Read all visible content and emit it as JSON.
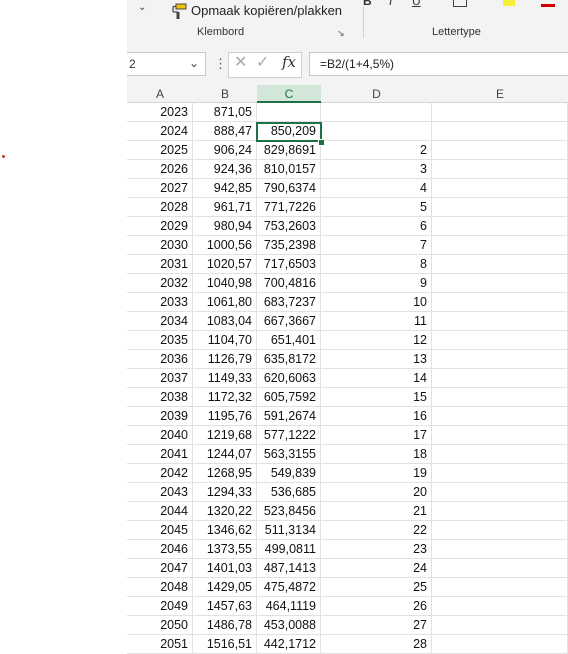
{
  "ribbon": {
    "copy_format_label": "Opmaak kopiëren/plakken",
    "clipboard_group": "Klembord",
    "font_group": "Lettertype",
    "bold": "B",
    "italic": "I",
    "underline": "U"
  },
  "formula_bar": {
    "name_box": "2",
    "formula": "=B2/(1+4,5%)",
    "fx": "fx"
  },
  "columns": [
    "A",
    "B",
    "C",
    "D",
    "E"
  ],
  "selected_column": "C",
  "active_cell": "C2",
  "accent_color": "#1e7145",
  "rows": [
    {
      "a": "2023",
      "b": "871,05",
      "c": "",
      "d": ""
    },
    {
      "a": "2024",
      "b": "888,47",
      "c": "850,209",
      "d": ""
    },
    {
      "a": "2025",
      "b": "906,24",
      "c": "829,8691",
      "d": "2"
    },
    {
      "a": "2026",
      "b": "924,36",
      "c": "810,0157",
      "d": "3"
    },
    {
      "a": "2027",
      "b": "942,85",
      "c": "790,6374",
      "d": "4"
    },
    {
      "a": "2028",
      "b": "961,71",
      "c": "771,7226",
      "d": "5"
    },
    {
      "a": "2029",
      "b": "980,94",
      "c": "753,2603",
      "d": "6"
    },
    {
      "a": "2030",
      "b": "1000,56",
      "c": "735,2398",
      "d": "7"
    },
    {
      "a": "2031",
      "b": "1020,57",
      "c": "717,6503",
      "d": "8"
    },
    {
      "a": "2032",
      "b": "1040,98",
      "c": "700,4816",
      "d": "9"
    },
    {
      "a": "2033",
      "b": "1061,80",
      "c": "683,7237",
      "d": "10"
    },
    {
      "a": "2034",
      "b": "1083,04",
      "c": "667,3667",
      "d": "11"
    },
    {
      "a": "2035",
      "b": "1104,70",
      "c": "651,401",
      "d": "12"
    },
    {
      "a": "2036",
      "b": "1126,79",
      "c": "635,8172",
      "d": "13"
    },
    {
      "a": "2037",
      "b": "1149,33",
      "c": "620,6063",
      "d": "14"
    },
    {
      "a": "2038",
      "b": "1172,32",
      "c": "605,7592",
      "d": "15"
    },
    {
      "a": "2039",
      "b": "1195,76",
      "c": "591,2674",
      "d": "16"
    },
    {
      "a": "2040",
      "b": "1219,68",
      "c": "577,1222",
      "d": "17"
    },
    {
      "a": "2041",
      "b": "1244,07",
      "c": "563,3155",
      "d": "18"
    },
    {
      "a": "2042",
      "b": "1268,95",
      "c": "549,839",
      "d": "19"
    },
    {
      "a": "2043",
      "b": "1294,33",
      "c": "536,685",
      "d": "20"
    },
    {
      "a": "2044",
      "b": "1320,22",
      "c": "523,8456",
      "d": "21"
    },
    {
      "a": "2045",
      "b": "1346,62",
      "c": "511,3134",
      "d": "22"
    },
    {
      "a": "2046",
      "b": "1373,55",
      "c": "499,0811",
      "d": "23"
    },
    {
      "a": "2047",
      "b": "1401,03",
      "c": "487,1413",
      "d": "24"
    },
    {
      "a": "2048",
      "b": "1429,05",
      "c": "475,4872",
      "d": "25"
    },
    {
      "a": "2049",
      "b": "1457,63",
      "c": "464,1119",
      "d": "26"
    },
    {
      "a": "2050",
      "b": "1486,78",
      "c": "453,0088",
      "d": "27"
    },
    {
      "a": "2051",
      "b": "1516,51",
      "c": "442,1712",
      "d": "28"
    }
  ]
}
